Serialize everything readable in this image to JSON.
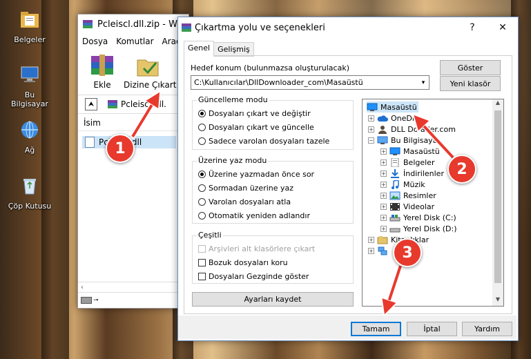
{
  "desktop": {
    "icons": [
      {
        "label": "Belgeler",
        "icon": "documents-folder-icon"
      },
      {
        "label": "Bu Bilgisayar",
        "icon": "computer-icon"
      },
      {
        "label": "Ağ",
        "icon": "network-icon"
      },
      {
        "label": "Çöp Kutusu",
        "icon": "recycle-bin-icon"
      }
    ]
  },
  "winrar": {
    "title": "Pcleiscl.dll.zip - Win",
    "menu": [
      "Dosya",
      "Komutlar",
      "Araçla"
    ],
    "toolbar": {
      "add": "Ekle",
      "extract": "Dizine Çıkart"
    },
    "path": "Pcleiscl.dll.",
    "column_name": "İsim",
    "file_name": "Pcleiscl.dll"
  },
  "dialog": {
    "title": "Çıkartma yolu ve seçenekleri",
    "tabs": [
      "Genel",
      "Gelişmiş"
    ],
    "dest_label": "Hedef konum (bulunmazsa oluşturulacak)",
    "dest_value": "C:\\Kullanıcılar\\DllDownloader_com\\Masaüstü",
    "show_button": "Göster",
    "new_folder_button": "Yeni klasör",
    "update_mode": {
      "title": "Güncelleme modu",
      "options": [
        "Dosyaları çıkart ve değiştir",
        "Dosyaları çıkart ve güncelle",
        "Sadece varolan dosyaları tazele"
      ],
      "selected": 0
    },
    "overwrite_mode": {
      "title": "Üzerine yaz modu",
      "options": [
        "Üzerine yazmadan önce sor",
        "Sormadan üzerine yaz",
        "Varolan dosyaları atla",
        "Otomatik yeniden adlandır"
      ],
      "selected": 0
    },
    "misc": {
      "title": "Çeşitli",
      "options": [
        "Arşivleri alt klasörlere çıkart",
        "Bozuk dosyaları koru",
        "Dosyaları Gezginde göster"
      ]
    },
    "save_settings": "Ayarları kaydet",
    "tree": [
      {
        "label": "Masaüstü",
        "icon": "desktop-icon",
        "selected": true
      },
      {
        "label": "OneDr",
        "icon": "onedrive-icon"
      },
      {
        "label": "DLL Do        ader.com",
        "icon": "user-icon"
      },
      {
        "label": "Bu Bilgisaya",
        "icon": "computer-icon"
      },
      {
        "label": "Masaüstü",
        "icon": "desktop-icon"
      },
      {
        "label": "Belgeler",
        "icon": "documents-icon"
      },
      {
        "label": "İndirilenler",
        "icon": "downloads-icon"
      },
      {
        "label": "Müzik",
        "icon": "music-icon"
      },
      {
        "label": "Resimler",
        "icon": "pictures-icon"
      },
      {
        "label": "Videolar",
        "icon": "videos-icon"
      },
      {
        "label": "Yerel Disk (C:)",
        "icon": "drive-icon"
      },
      {
        "label": "Yerel Disk (D:)",
        "icon": "drive-icon"
      },
      {
        "label": "Kitaplıklar",
        "icon": "libraries-icon"
      },
      {
        "label": "",
        "icon": "network-icon"
      }
    ],
    "buttons": {
      "ok": "Tamam",
      "cancel": "İptal",
      "help": "Yardım"
    }
  },
  "callouts": [
    "1",
    "2",
    "3"
  ]
}
